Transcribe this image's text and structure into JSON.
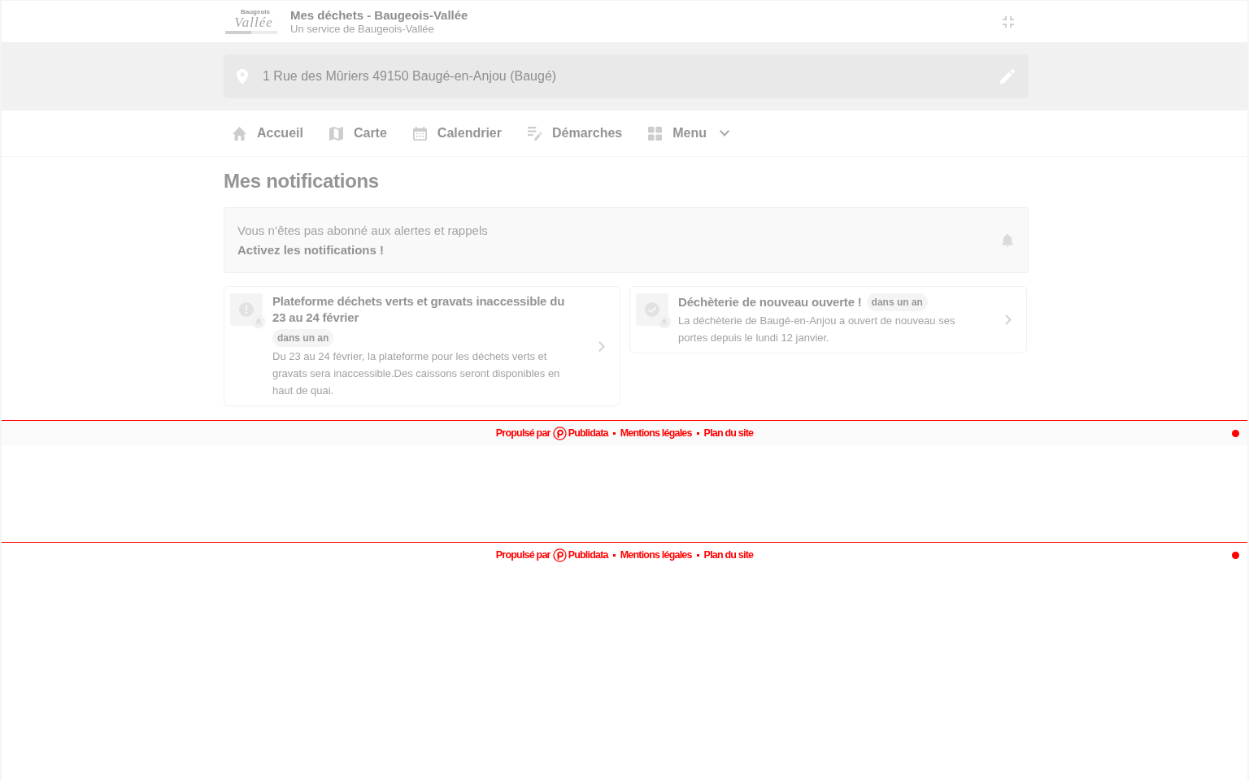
{
  "header": {
    "logo": {
      "top": "Baugeois",
      "script": "Vallée"
    },
    "title": "Mes déchets - Baugeois-Vallée",
    "subtitle": "Un service de Baugeois-Vallée"
  },
  "address": {
    "value": "1 Rue des Mûriers 49150 Baugé-en-Anjou (Baugé)"
  },
  "nav": [
    {
      "kind": "home",
      "label": "Accueil"
    },
    {
      "kind": "map",
      "label": "Carte"
    },
    {
      "kind": "calendar",
      "label": "Calendrier"
    },
    {
      "kind": "form",
      "label": "Démarches"
    },
    {
      "kind": "menu",
      "label": "Menu"
    }
  ],
  "page_title": "Mes notifications",
  "alert": {
    "message": "Vous n’êtes pas abonné aux alertes et rappels",
    "action": "Activez les notifications !"
  },
  "notifications": [
    {
      "kind": "warning",
      "title": "Plateforme déchets verts et gravats inaccessible du 23 au 24 février",
      "badge": "dans un an",
      "text": "Du 23 au 24 février, la plateforme pour les déchets verts et gravats sera inaccessible.Des caissons seront disponibles en haut de quai."
    },
    {
      "kind": "success",
      "title": "Déchèterie de nouveau ouverte !",
      "badge": "dans un an",
      "text": "La déchèterie de Baugé-en-Anjou a ouvert de nouveau ses portes depuis le lundi 12 janvier."
    }
  ],
  "footers": [
    {
      "powered_by": "Propulsé par",
      "brand": "Publidata",
      "links": [
        "Mentions légales",
        "Plan du site"
      ]
    },
    {
      "powered_by": "Propulsé par",
      "brand": "Publidata",
      "links": [
        "Mentions légales",
        "Plan du site"
      ]
    }
  ]
}
